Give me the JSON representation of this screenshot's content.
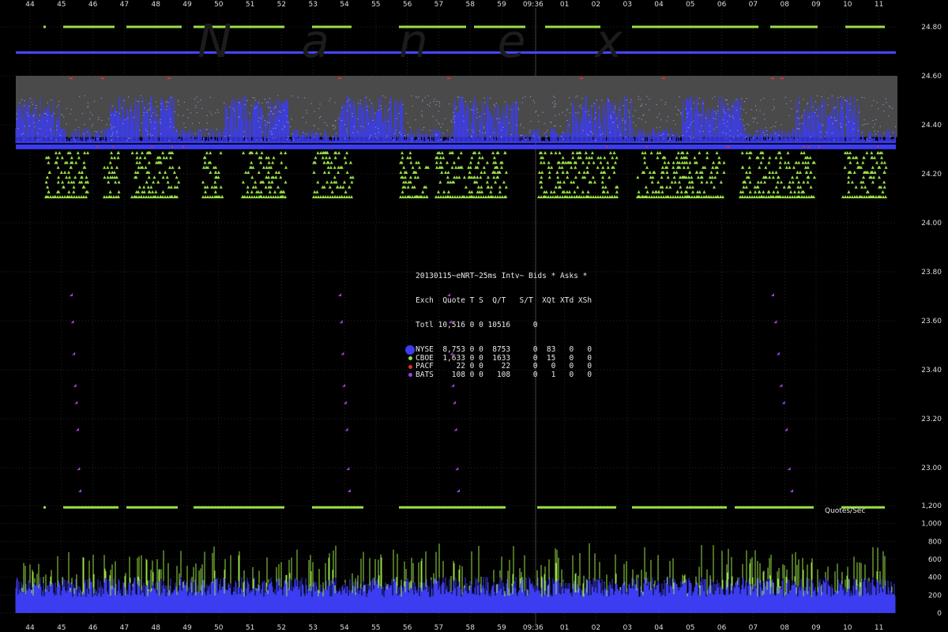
{
  "watermark": "Nanex",
  "chart_data": {
    "type": "scatter",
    "title": "20130115~eNRT~25ms Intv~ Bids * Asks *",
    "x_ticks": [
      "44",
      "45",
      "46",
      "47",
      "48",
      "49",
      "50",
      "51",
      "52",
      "53",
      "54",
      "55",
      "56",
      "57",
      "58",
      "59",
      "09:36",
      "01",
      "02",
      "03",
      "04",
      "05",
      "06",
      "07",
      "08",
      "09",
      "10",
      "11"
    ],
    "center_time_label": "09:36",
    "price_axis": {
      "ticks": [
        "24.80",
        "24.60",
        "24.40",
        "24.20",
        "24.00",
        "23.80",
        "23.60",
        "23.40",
        "23.20",
        "23.00"
      ],
      "ylim": [
        23.0,
        24.8
      ]
    },
    "volume_axis": {
      "label": "Quotes/Sec",
      "ticks": [
        "1,200",
        "1,000",
        "800",
        "600",
        "400",
        "200",
        "0"
      ],
      "ylim": [
        0,
        1200
      ]
    },
    "bands": {
      "best_ask": 24.695,
      "best_bid": 24.31,
      "nbbo_gray_band": [
        24.35,
        24.6
      ],
      "nyse_ask_range": [
        24.33,
        24.52
      ],
      "cboe_bid_range": [
        24.1,
        24.3
      ],
      "cboe_ask_level": 24.8,
      "cboe_low_level": 1180,
      "pacf_level": 24.59,
      "bats_levels": [
        23.7,
        23.59,
        23.46,
        23.33,
        23.26,
        23.15,
        22.99,
        22.9
      ]
    },
    "series": [
      {
        "name": "NYSE",
        "color": "#3c3cf0"
      },
      {
        "name": "CBOE",
        "color": "#98e046"
      },
      {
        "name": "PACF",
        "color": "#e03030"
      },
      {
        "name": "BATS",
        "color": "#a040e0"
      }
    ]
  },
  "legend": {
    "title": "20130115~eNRT~25ms Intv~ Bids * Asks *",
    "header": "Exch  Quote T S  Q/T   S/T  XQt XTd XSh",
    "total": "Totl 10,516 0 0 10516     0",
    "rows": [
      {
        "name": "NYSE",
        "text": "NYSE  8,753 0 0  8753     0  83   0   0",
        "color": "#3c3cf0",
        "size": 12
      },
      {
        "name": "CBOE",
        "text": "CBOE  1,633 0 0  1633     0  15   0   0",
        "color": "#98e046",
        "size": 5
      },
      {
        "name": "PACF",
        "text": "PACF     22 0 0    22     0   0   0   0",
        "color": "#e03030",
        "size": 5
      },
      {
        "name": "BATS",
        "text": "BATS    108 0 0   108     0   1   0   0",
        "color": "#a040e0",
        "size": 5
      }
    ]
  }
}
